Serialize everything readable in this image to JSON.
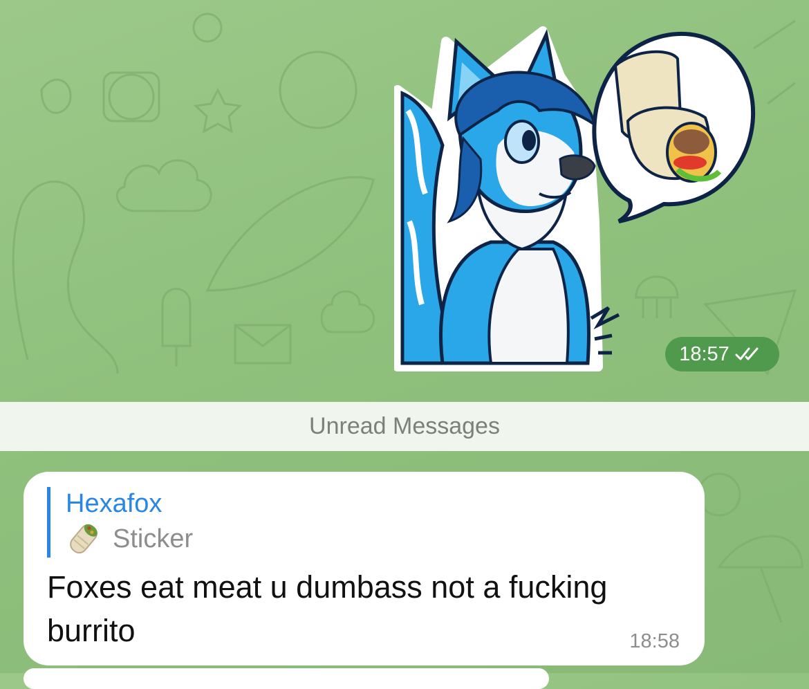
{
  "sticker": {
    "emoji": "🌯",
    "time": "18:57",
    "status_icon": "double-check-icon"
  },
  "divider": {
    "label": "Unread Messages"
  },
  "message": {
    "reply_author": "Hexafox",
    "reply_icon": "burrito-emoji-icon",
    "reply_text": "Sticker",
    "text": "Foxes eat meat u dumbass not a fucking burrito",
    "time": "18:58"
  },
  "colors": {
    "chat_background": "#8fc07c",
    "outgoing_time_pill": "#4f9a4c",
    "reply_accent": "#2a86e6",
    "fox_blue": "#2aa7e8",
    "fox_dark_blue": "#1a5fae"
  }
}
